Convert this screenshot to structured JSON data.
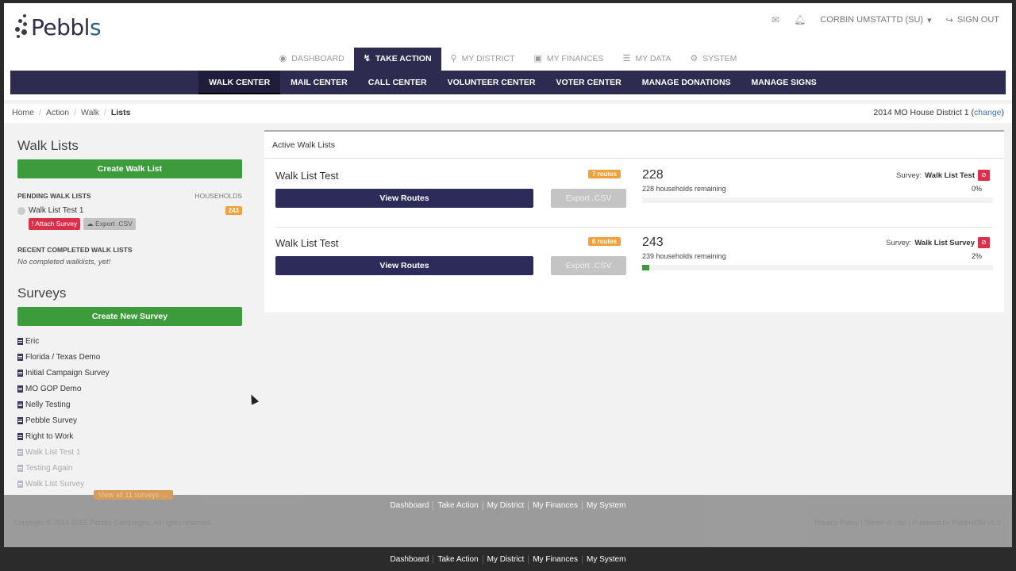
{
  "brand": {
    "logo_text": "Pebbl",
    "logo_tail": "s"
  },
  "user_nav": {
    "mail_icon": "envelope-icon",
    "bell_icon": "bell-icon",
    "user": "CORBIN UMSTATTD (SU)",
    "signout": "SIGN OUT"
  },
  "main_tabs": [
    {
      "label": "DASHBOARD",
      "icon": "dashboard-icon"
    },
    {
      "label": "TAKE ACTION",
      "icon": "bolt-icon",
      "active": true
    },
    {
      "label": "MY DISTRICT",
      "icon": "map-pin-icon"
    },
    {
      "label": "MY FINANCES",
      "icon": "money-icon"
    },
    {
      "label": "MY DATA",
      "icon": "database-icon"
    },
    {
      "label": "SYSTEM",
      "icon": "gear-icon"
    }
  ],
  "subnav": [
    {
      "label": "WALK CENTER",
      "active": true
    },
    {
      "label": "MAIL CENTER"
    },
    {
      "label": "CALL CENTER"
    },
    {
      "label": "VOLUNTEER CENTER"
    },
    {
      "label": "VOTER CENTER"
    },
    {
      "label": "MANAGE DONATIONS"
    },
    {
      "label": "MANAGE SIGNS"
    }
  ],
  "breadcrumb": [
    "Home",
    "Action",
    "Walk",
    "Lists"
  ],
  "district": {
    "name": "2014 MO House District 1",
    "change": "change"
  },
  "sidebar": {
    "walk_lists_title": "Walk Lists",
    "create_walk_list": "Create Walk List",
    "pending_header": "PENDING WALK LISTS",
    "households_header": "HOUSEHOLDS",
    "pending": [
      {
        "name": "Walk List Test 1",
        "households": "243",
        "attach": "! Attach Survey",
        "export": "Export .CSV"
      }
    ],
    "recent_header": "RECENT COMPLETED WALK LISTS",
    "recent_empty": "No completed walklists, yet!",
    "surveys_title": "Surveys",
    "create_survey": "Create New Survey",
    "surveys": [
      {
        "name": "Eric"
      },
      {
        "name": "Florida / Texas Demo"
      },
      {
        "name": "Initial Campaign Survey"
      },
      {
        "name": "MO GOP Demo"
      },
      {
        "name": "Nelly Testing"
      },
      {
        "name": "Pebble Survey"
      },
      {
        "name": "Right to Work"
      },
      {
        "name": "Walk List Test 1",
        "faded": true
      },
      {
        "name": "Testing Again",
        "faded": true
      },
      {
        "name": "Walk List Survey",
        "faded": true
      }
    ],
    "view_all": "View all 11 surveys →"
  },
  "active_walk_lists": {
    "title": "Active Walk Lists",
    "rows": [
      {
        "name": "Walk List Test",
        "routes": "7 routes",
        "view_routes": "View Routes",
        "export": "Export .CSV",
        "count": "228",
        "remaining": "228 households remaining",
        "survey_label": "Survey:",
        "survey_name": "Walk List Test",
        "percent": "0%",
        "progress": 0
      },
      {
        "name": "Walk List Test",
        "routes": "6 routes",
        "view_routes": "View Routes",
        "export": "Export .CSV",
        "count": "243",
        "remaining": "239 households remaining",
        "survey_label": "Survey:",
        "survey_name": "Walk List Survey",
        "percent": "2%",
        "progress": 0.02
      }
    ]
  },
  "footer": {
    "links": [
      "Dashboard",
      "Take Action",
      "My District",
      "My Finances",
      "My System"
    ],
    "copyright": "Copyright © 2014-2015 Pebble Campaigns. All rights reserved.",
    "legal": "Privacy Policy | Terms of Use | Powered by PebbleCM v1.0"
  },
  "bottom_links": [
    "Dashboard",
    "Take Action",
    "My District",
    "My Finances",
    "My System"
  ],
  "colors": {
    "navy": "#2d2b4f",
    "green": "#3c9c3c",
    "orange": "#f0a03c",
    "red": "#d9314a"
  }
}
